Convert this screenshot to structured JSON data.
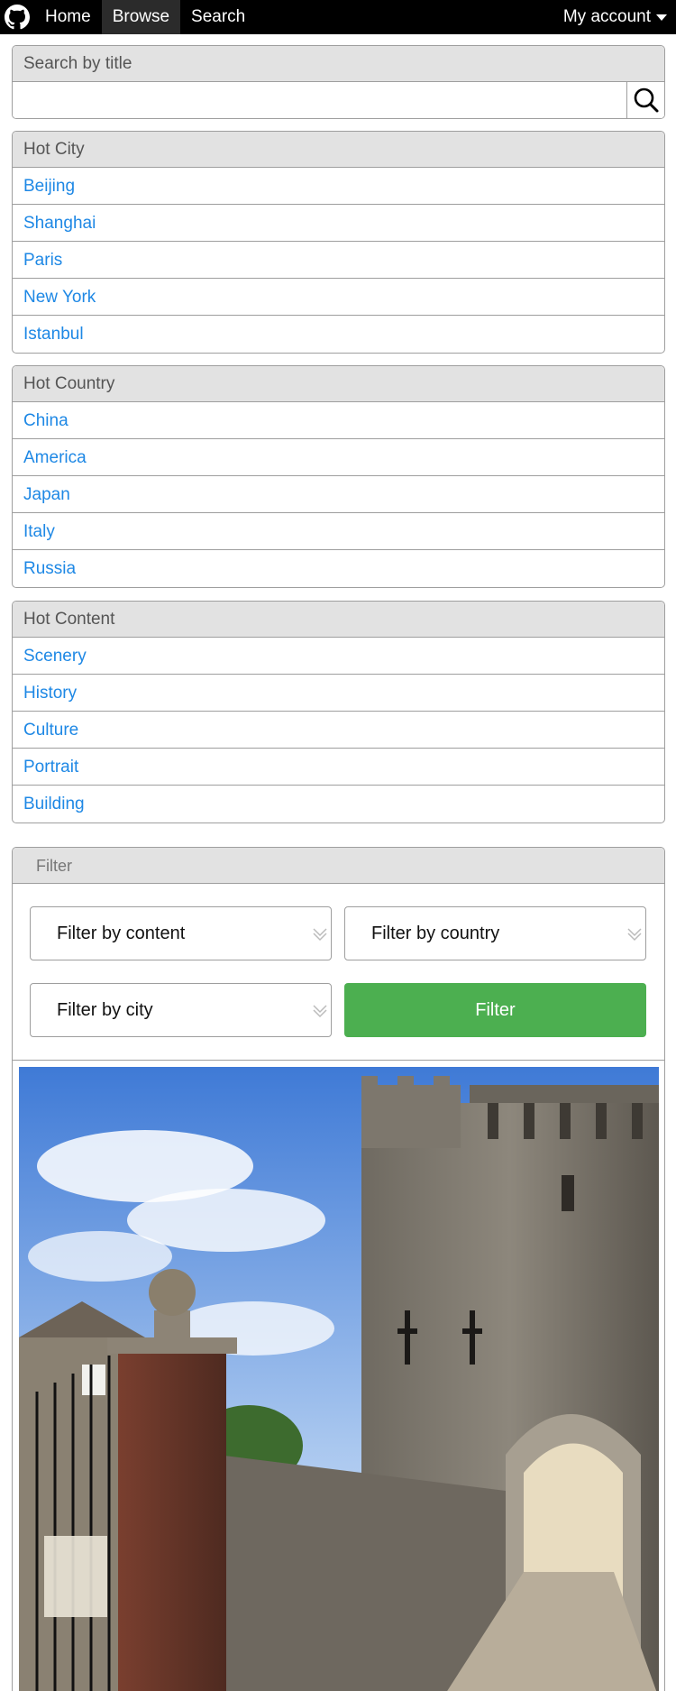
{
  "nav": {
    "home": "Home",
    "browse": "Browse",
    "search": "Search",
    "account": "My account"
  },
  "search": {
    "title": "Search by title",
    "placeholder": ""
  },
  "hot_city": {
    "title": "Hot City",
    "items": [
      "Beijing",
      "Shanghai",
      "Paris",
      "New York",
      "Istanbul"
    ]
  },
  "hot_country": {
    "title": "Hot Country",
    "items": [
      "China",
      "America",
      "Japan",
      "Italy",
      "Russia"
    ]
  },
  "hot_content": {
    "title": "Hot Content",
    "items": [
      "Scenery",
      "History",
      "Culture",
      "Portrait",
      "Building"
    ]
  },
  "filter": {
    "title": "Filter",
    "by_content": "Filter by content",
    "by_country": "Filter by country",
    "by_city": "Filter by city",
    "button": "Filter"
  },
  "colors": {
    "link": "#1e88e5",
    "filter_button": "#4caf50",
    "nav_bg": "#000000"
  }
}
